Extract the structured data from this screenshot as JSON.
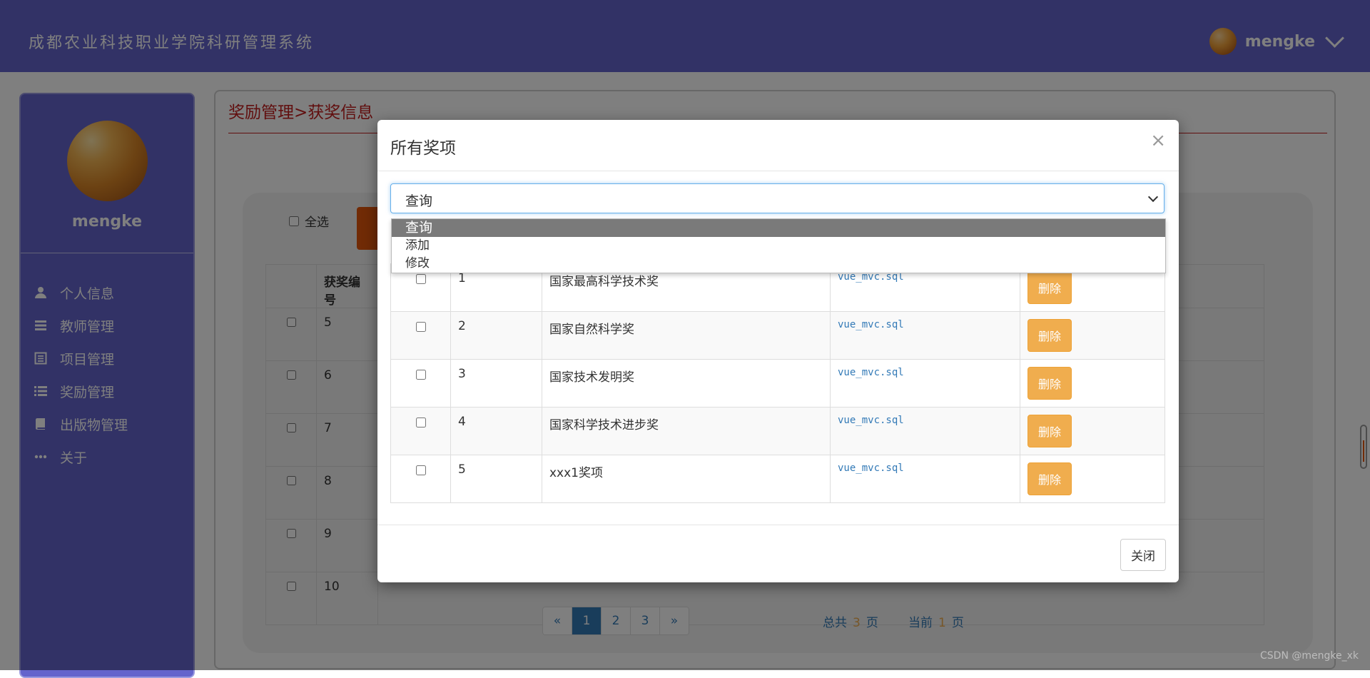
{
  "header": {
    "title": "成都农业科技职业学院科研管理系统",
    "username": "mengke"
  },
  "sidebar": {
    "username": "mengke",
    "items": [
      {
        "label": "个人信息",
        "icon": "user-icon"
      },
      {
        "label": "教师管理",
        "icon": "list-icon"
      },
      {
        "label": "项目管理",
        "icon": "document-icon"
      },
      {
        "label": "奖励管理",
        "icon": "list-bullets-icon"
      },
      {
        "label": "出版物管理",
        "icon": "book-icon"
      },
      {
        "label": "关于",
        "icon": "more-icon"
      }
    ]
  },
  "main": {
    "breadcrumb": "奖励管理>获奖信息",
    "select_all": "全选",
    "table_header": "获奖编号",
    "rows": [
      "5",
      "6",
      "7",
      "8",
      "9",
      "10"
    ],
    "pagination": {
      "prev": "«",
      "pages": [
        "1",
        "2",
        "3"
      ],
      "next": "»",
      "current": "1"
    },
    "page_info": {
      "total_prefix": "总共",
      "total": "3",
      "total_suffix": "页",
      "current_prefix": "当前",
      "current": "1",
      "current_suffix": "页"
    }
  },
  "modal": {
    "title": "所有奖项",
    "close_symbol": "×",
    "select": {
      "value": "查询",
      "options": [
        "查询",
        "添加",
        "修改"
      ]
    },
    "rows": [
      {
        "id": "1",
        "name": "国家最高科学技术奖",
        "file": "vue_mvc.sql",
        "action": "删除"
      },
      {
        "id": "2",
        "name": "国家自然科学奖",
        "file": "vue_mvc.sql",
        "action": "删除"
      },
      {
        "id": "3",
        "name": "国家技术发明奖",
        "file": "vue_mvc.sql",
        "action": "删除"
      },
      {
        "id": "4",
        "name": "国家科学技术进步奖",
        "file": "vue_mvc.sql",
        "action": "删除"
      },
      {
        "id": "5",
        "name": "xxx1奖项",
        "file": "vue_mvc.sql",
        "action": "删除"
      }
    ],
    "close_button": "关闭"
  },
  "watermark": "CSDN @mengke_xk",
  "colors": {
    "brand": "#6464cc",
    "danger": "#c21f1f",
    "warning": "#f0ad4e",
    "link": "#337ab7"
  }
}
